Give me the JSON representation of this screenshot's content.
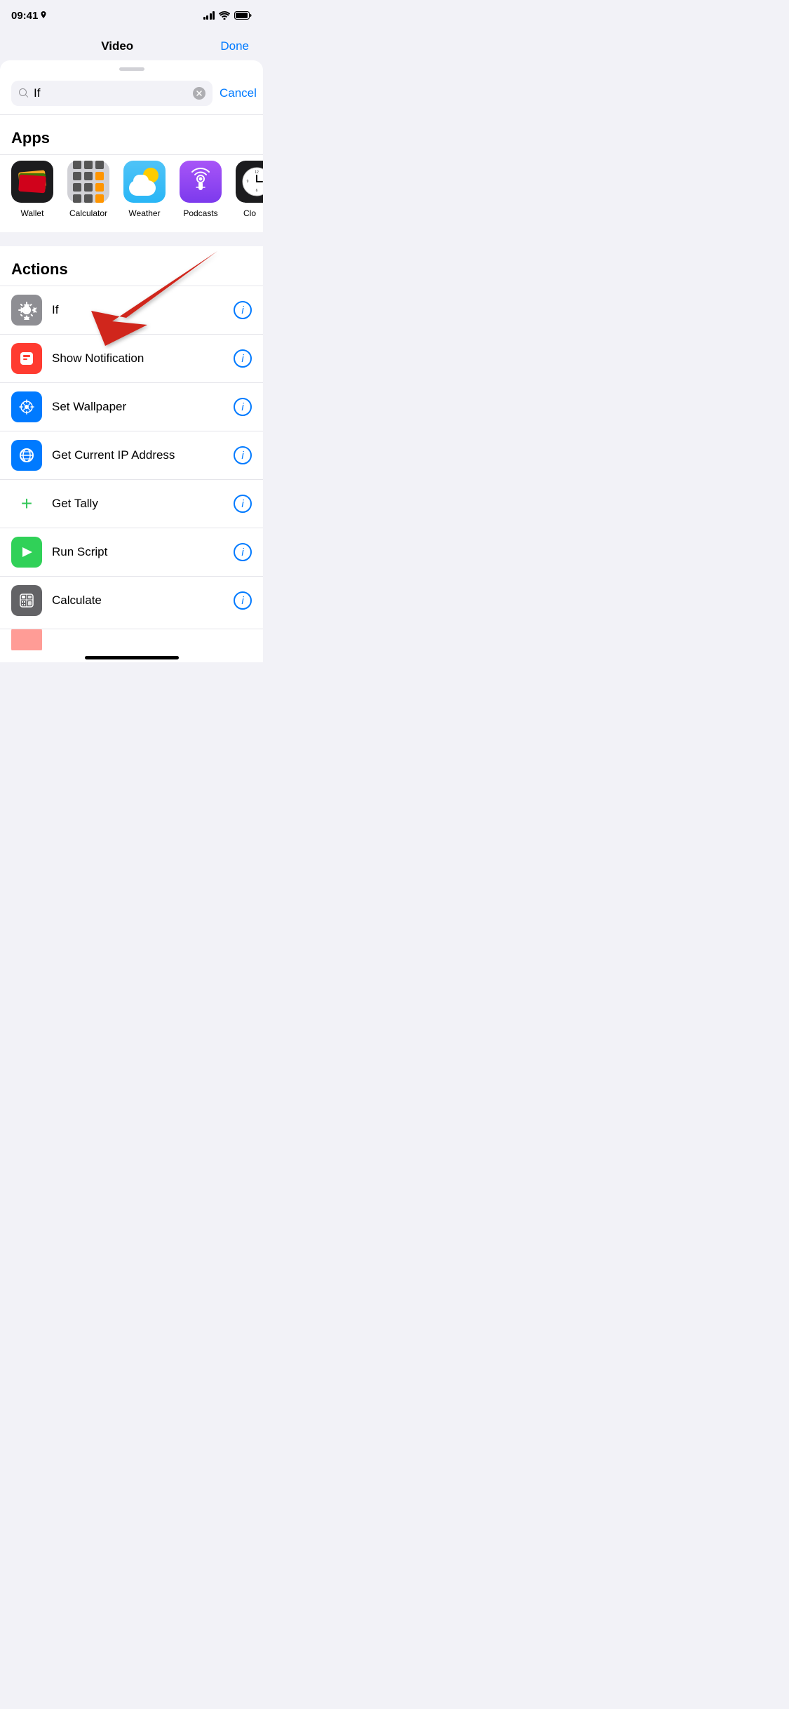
{
  "statusBar": {
    "time": "09:41",
    "hasLocation": true
  },
  "topBar": {
    "title": "Video",
    "doneLabel": "Done"
  },
  "search": {
    "value": "If",
    "placeholder": "Search",
    "cancelLabel": "Cancel"
  },
  "appsSection": {
    "header": "Apps",
    "apps": [
      {
        "id": "wallet",
        "label": "Wallet"
      },
      {
        "id": "calculator",
        "label": "Calculator"
      },
      {
        "id": "weather",
        "label": "Weather"
      },
      {
        "id": "podcasts",
        "label": "Podcasts"
      },
      {
        "id": "clock",
        "label": "Clo"
      }
    ]
  },
  "actionsSection": {
    "header": "Actions",
    "items": [
      {
        "id": "if",
        "label": "If"
      },
      {
        "id": "show-notification",
        "label": "Show Notification"
      },
      {
        "id": "set-wallpaper",
        "label": "Set Wallpaper"
      },
      {
        "id": "get-ip",
        "label": "Get Current IP Address"
      },
      {
        "id": "get-tally",
        "label": "Get Tally"
      },
      {
        "id": "run-script",
        "label": "Run Script"
      },
      {
        "id": "calculate",
        "label": "Calculate"
      }
    ]
  }
}
